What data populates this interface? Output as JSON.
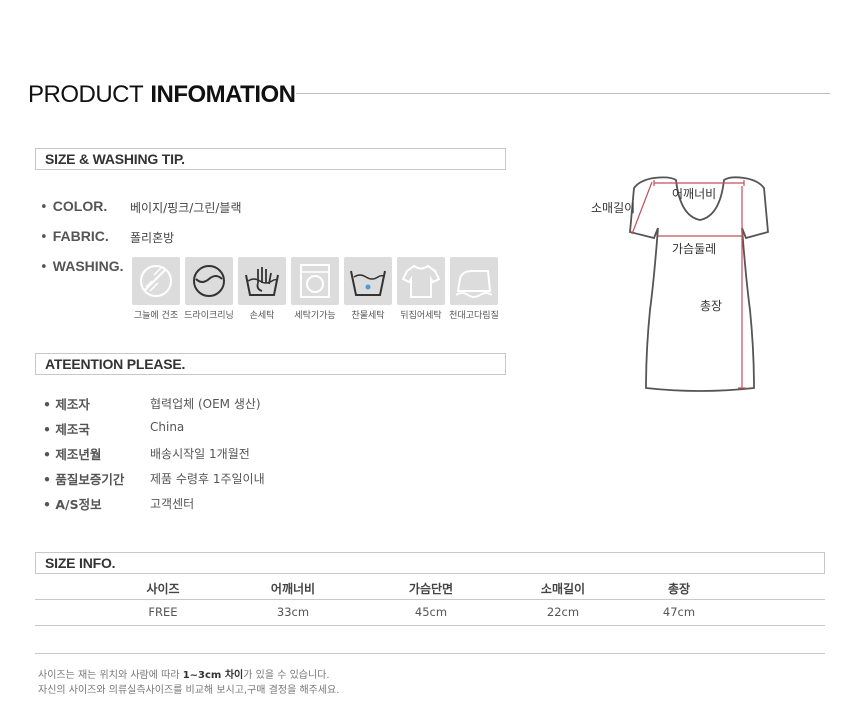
{
  "header": {
    "title_light": "PRODUCT",
    "title_bold": "INFOMATION"
  },
  "size_washing": {
    "section_title": "SIZE & WASHING TIP.",
    "color_label": "COLOR.",
    "color_value": "베이지/핑크/그린/블랙",
    "fabric_label": "FABRIC.",
    "fabric_value": "폴리혼방",
    "washing_label": "WASHING.",
    "washing_icons": [
      {
        "icon": "shade-dry-icon",
        "caption": "그늘에 건조"
      },
      {
        "icon": "dry-clean-icon",
        "caption": "드라이크리닝"
      },
      {
        "icon": "hand-wash-icon",
        "caption": "손세탁"
      },
      {
        "icon": "machine-wash-icon",
        "caption": "세탁기가능"
      },
      {
        "icon": "cold-wash-icon",
        "caption": "찬물세탁"
      },
      {
        "icon": "inside-out-wash-icon",
        "caption": "뒤집어세탁"
      },
      {
        "icon": "iron-cloth-icon",
        "caption": "천대고다림질"
      }
    ]
  },
  "diagram": {
    "shoulder": "어깨너비",
    "sleeve": "소매길이",
    "chest": "가슴둘레",
    "length": "총장"
  },
  "attention": {
    "section_title": "ATEENTION PLEASE.",
    "rows": [
      {
        "label": "제조자",
        "value": "협력업체 (OEM 생산)"
      },
      {
        "label": "제조국",
        "value": "China"
      },
      {
        "label": "제조년월",
        "value": "배송시작일 1개월전"
      },
      {
        "label": "품질보증기간",
        "value": "제품 수령후 1주일이내"
      },
      {
        "label": "A/S정보",
        "value": "고객센터"
      }
    ]
  },
  "size_info": {
    "section_title": "SIZE INFO.",
    "headers": [
      "사이즈",
      "어깨너비",
      "가슴단면",
      "소매길이",
      "총장"
    ],
    "row": [
      "FREE",
      "33cm",
      "45cm",
      "22cm",
      "47cm"
    ]
  },
  "notes": {
    "line1_a": "사이즈는 재는 위치와 사람에 따라 ",
    "line1_b": "1~3cm 차이",
    "line1_c": "가 있을 수 있습니다.",
    "line2": "자신의 사이즈와 의류실측사이즈를 비교해 보시고,구매 결정을 해주세요."
  },
  "colors": {
    "accent_line": "#c0505a",
    "icon_bg": "#dcdcdc"
  }
}
